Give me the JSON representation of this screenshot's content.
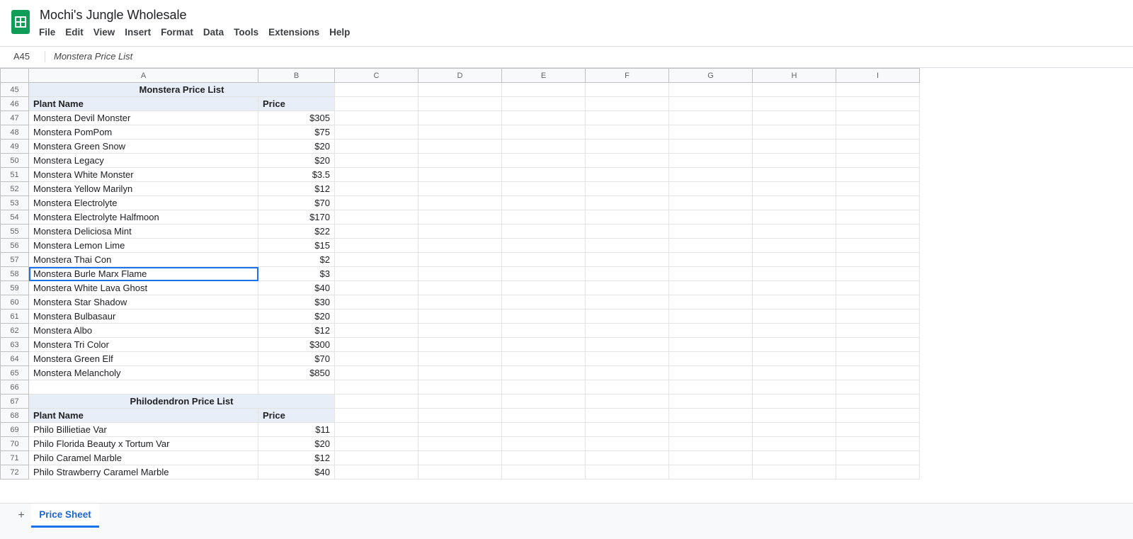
{
  "doc": {
    "title": "Mochi's Jungle Wholesale"
  },
  "menu": [
    "File",
    "Edit",
    "View",
    "Insert",
    "Format",
    "Data",
    "Tools",
    "Extensions",
    "Help"
  ],
  "formula_bar": {
    "name_box": "A45",
    "content": "Monstera Price List"
  },
  "columns": [
    "A",
    "B",
    "C",
    "D",
    "E",
    "F",
    "G",
    "H",
    "I"
  ],
  "rows": [
    {
      "n": "45",
      "type": "title",
      "a": "Monstera Price List",
      "b": ""
    },
    {
      "n": "46",
      "type": "header",
      "a": "Plant Name",
      "b": "Price"
    },
    {
      "n": "47",
      "a": "Monstera Devil Monster",
      "b": "$305"
    },
    {
      "n": "48",
      "a": "Monstera PomPom",
      "b": "$75"
    },
    {
      "n": "49",
      "a": "Monstera Green Snow",
      "b": "$20"
    },
    {
      "n": "50",
      "a": "Monstera Legacy",
      "b": "$20"
    },
    {
      "n": "51",
      "a": "Monstera White Monster",
      "b": "$3.5"
    },
    {
      "n": "52",
      "a": "Monstera Yellow Marilyn",
      "b": "$12"
    },
    {
      "n": "53",
      "a": "Monstera Electrolyte",
      "b": "$70"
    },
    {
      "n": "54",
      "a": "Monstera Electrolyte Halfmoon",
      "b": "$170"
    },
    {
      "n": "55",
      "a": "Monstera Deliciosa Mint",
      "b": "$22"
    },
    {
      "n": "56",
      "a": "Monstera Lemon Lime",
      "b": "$15"
    },
    {
      "n": "57",
      "a": "Monstera Thai Con",
      "b": "$2"
    },
    {
      "n": "58",
      "a": "Monstera Burle Marx Flame",
      "b": "$3",
      "selected": true
    },
    {
      "n": "59",
      "a": "Monstera White Lava Ghost",
      "b": "$40"
    },
    {
      "n": "60",
      "a": "Monstera Star Shadow",
      "b": "$30"
    },
    {
      "n": "61",
      "a": "Monstera Bulbasaur",
      "b": "$20"
    },
    {
      "n": "62",
      "a": "Monstera Albo",
      "b": "$12"
    },
    {
      "n": "63",
      "a": "Monstera Tri Color",
      "b": "$300"
    },
    {
      "n": "64",
      "a": "Monstera Green Elf",
      "b": "$70"
    },
    {
      "n": "65",
      "a": "Monstera Melancholy",
      "b": "$850"
    },
    {
      "n": "66",
      "a": "",
      "b": ""
    },
    {
      "n": "67",
      "type": "title",
      "a": "Philodendron Price List",
      "b": ""
    },
    {
      "n": "68",
      "type": "header",
      "a": "Plant Name",
      "b": "Price"
    },
    {
      "n": "69",
      "a": "Philo Billietiae Var",
      "b": "$11"
    },
    {
      "n": "70",
      "a": "Philo Florida Beauty x Tortum Var",
      "b": "$20"
    },
    {
      "n": "71",
      "a": "Philo Caramel Marble",
      "b": "$12"
    },
    {
      "n": "72",
      "a": "Philo Strawberry Caramel Marble",
      "b": "$40"
    }
  ],
  "tabs": {
    "add_label": "+",
    "active": "Price Sheet"
  },
  "colors": {
    "brand": "#0f9d58",
    "accent": "#1a73e8",
    "band": "#e8eef7"
  }
}
